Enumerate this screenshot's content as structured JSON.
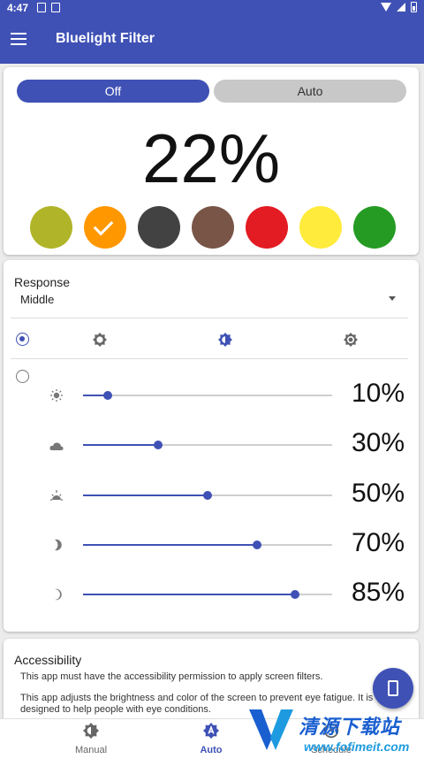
{
  "status_bar": {
    "time": "4:47"
  },
  "app_bar": {
    "title": "Bluelight Filter"
  },
  "filter_card": {
    "toggle_off": "Off",
    "toggle_auto": "Auto",
    "percent": "22%",
    "swatches": [
      {
        "color": "#b0b428",
        "selected": false
      },
      {
        "color": "#ff9800",
        "selected": true
      },
      {
        "color": "#424242",
        "selected": false
      },
      {
        "color": "#795548",
        "selected": false
      },
      {
        "color": "#e31b23",
        "selected": false
      },
      {
        "color": "#ffeb3b",
        "selected": false
      },
      {
        "color": "#259b24",
        "selected": false
      }
    ]
  },
  "response_card": {
    "label": "Response",
    "value": "Middle",
    "rows": [
      {
        "icon": "sun-icon",
        "value": 0.1,
        "label": "10%"
      },
      {
        "icon": "cloud-icon",
        "value": 0.3,
        "label": "30%"
      },
      {
        "icon": "sunset-icon",
        "value": 0.5,
        "label": "50%"
      },
      {
        "icon": "half-moon-icon",
        "value": 0.7,
        "label": "70%"
      },
      {
        "icon": "crescent-moon-icon",
        "value": 0.85,
        "label": "85%"
      }
    ]
  },
  "accessibility_card": {
    "title": "Accessibility",
    "p1": "This app must have the accessibility permission to apply screen filters.",
    "p2": "This app adjusts the brightness and color of the screen to prevent eye fatigue. It is",
    "p3": "designed to help people with eye conditions."
  },
  "bottom_nav": {
    "manual": "Manual",
    "auto": "Auto",
    "schedule": "Schedule"
  },
  "watermark": {
    "cn": "清源下载站",
    "url": "www.fofimeit.com"
  },
  "colors": {
    "primary": "#3f51b5"
  }
}
